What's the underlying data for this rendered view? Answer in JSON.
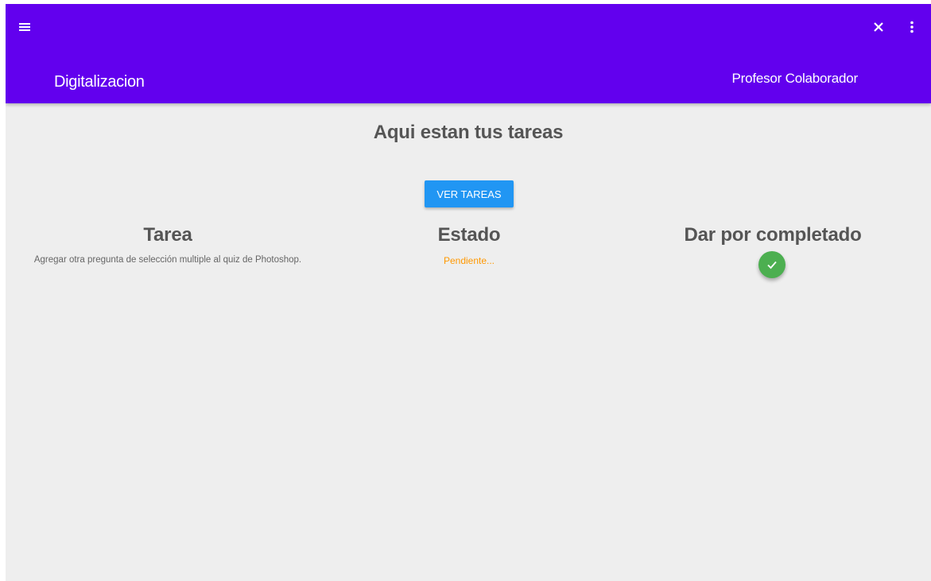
{
  "appbar": {
    "title": "Digitalizacion",
    "role": "Profesor Colaborador",
    "background_color": "#6200ee",
    "menu_icon": "menu-icon",
    "close_icon": "close-icon",
    "more_icon": "more-vert-icon"
  },
  "main": {
    "heading": "Aqui estan tus tareas",
    "ver_tareas_label": "VER TAREAS",
    "columns": {
      "tarea": "Tarea",
      "estado": "Estado",
      "completar": "Dar por completado"
    },
    "task": {
      "description": "Agregar otra pregunta de selección multiple al quiz de Photoshop.",
      "status": "Pendiente...",
      "status_color": "#ff9800",
      "complete_icon": "check-icon",
      "complete_color": "#4caf50"
    }
  }
}
